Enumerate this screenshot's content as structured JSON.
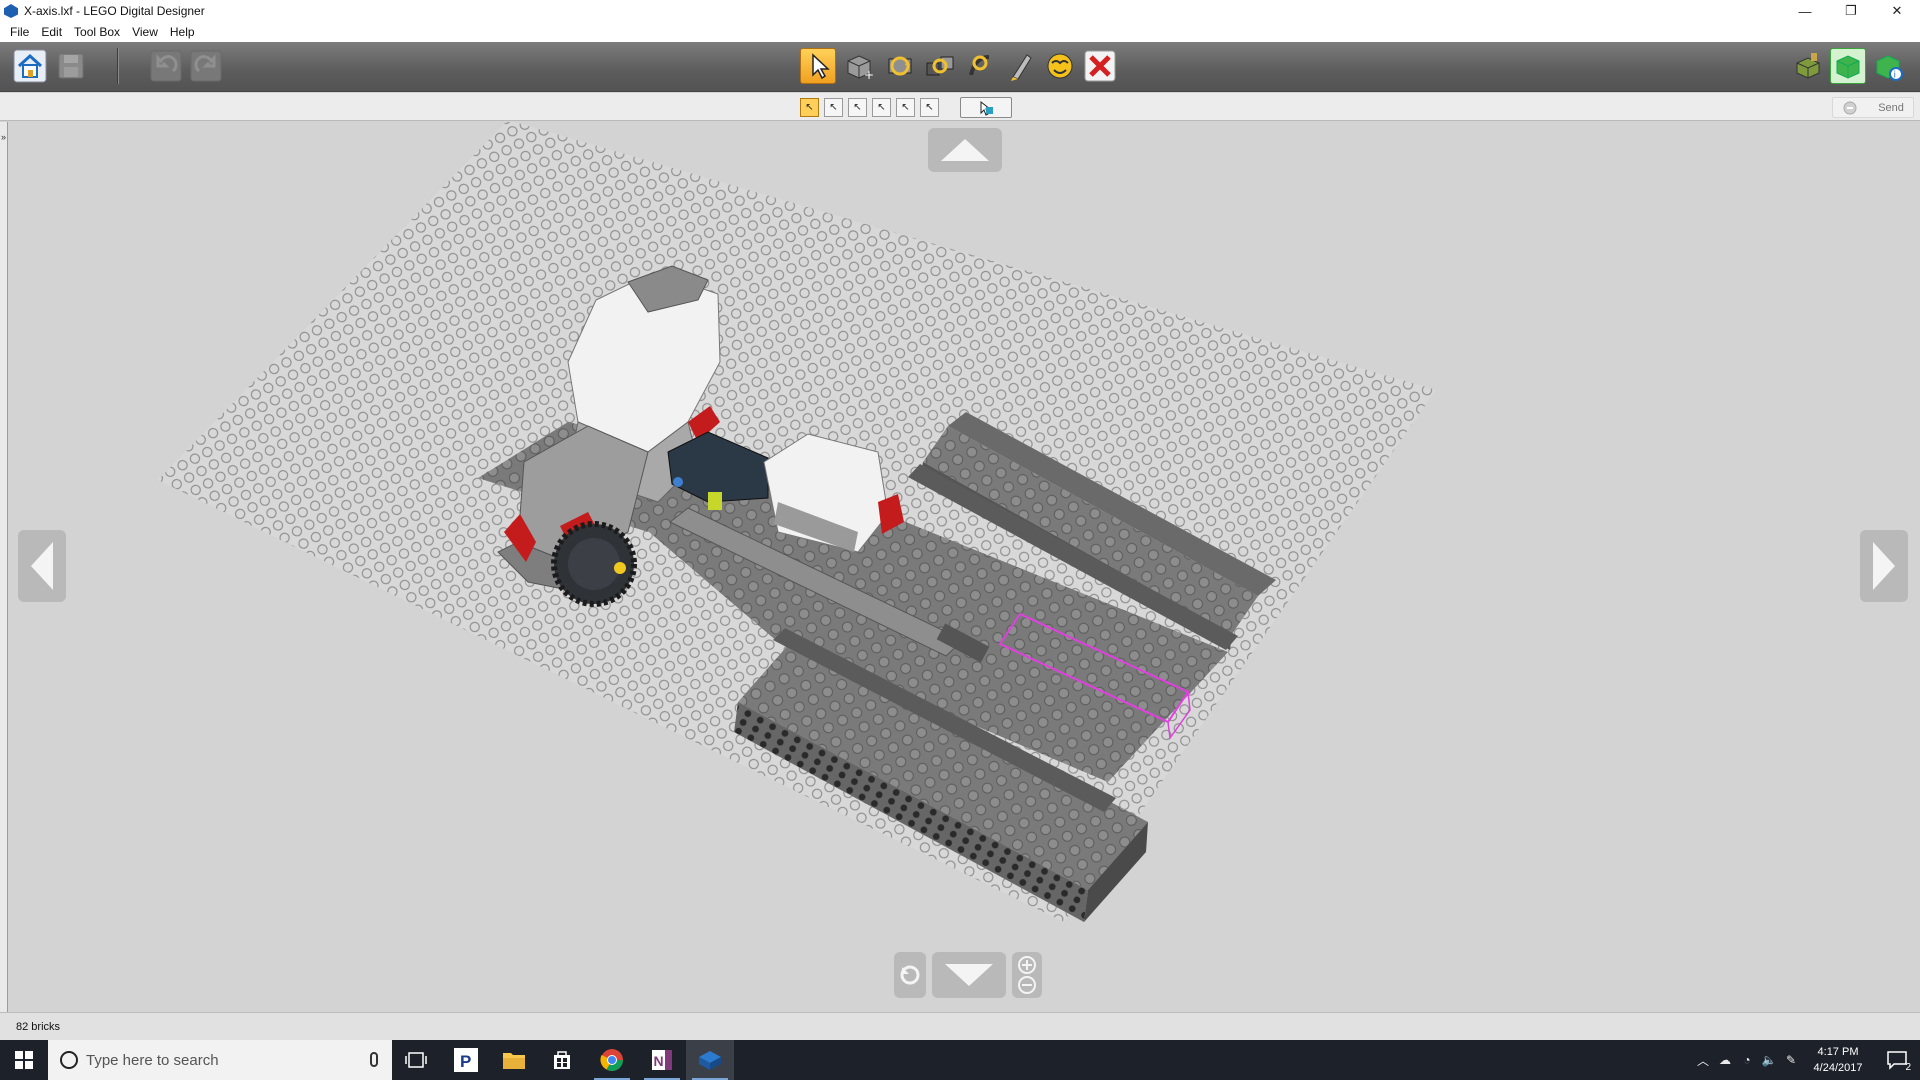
{
  "window": {
    "title": "X-axis.lxf - LEGO Digital Designer",
    "minimize_symbol": "—",
    "restore_symbol": "❐",
    "close_symbol": "✕"
  },
  "menu": [
    "File",
    "Edit",
    "Tool Box",
    "View",
    "Help"
  ],
  "toolbar": {
    "left_buttons": [
      "home-icon",
      "save-icon",
      "undo-icon",
      "redo-icon"
    ],
    "tool_buttons": [
      "select-tool-icon",
      "clone-tool-icon",
      "hinge-tool-icon",
      "hinge-align-tool-icon",
      "flex-tool-icon",
      "paint-tool-icon",
      "hide-tool-icon",
      "delete-tool-icon"
    ],
    "active_tool": "select-tool-icon",
    "mode_buttons": [
      "build-mode-icon",
      "view-mode-icon",
      "building-guide-icon"
    ]
  },
  "subtoolbar": {
    "select_modes": [
      "single-select-icon",
      "multi-select-icon",
      "connected-select-icon",
      "color-select-icon",
      "shape-select-icon",
      "invert-select-icon"
    ],
    "send_label": "Send"
  },
  "status": {
    "brick_count": "82 bricks"
  },
  "taskbar": {
    "search_placeholder": "Type here to search",
    "apps": [
      "task-view-icon",
      "pandora-icon",
      "file-explorer-icon",
      "store-icon",
      "chrome-icon",
      "onenote-icon",
      "lego-digital-designer-icon"
    ],
    "time": "4:17 PM",
    "date": "4/24/2017",
    "notification_count": "2"
  },
  "colors": {
    "accent_selected": "#ffc640",
    "selection_outline": "#e040e0",
    "baseplate": "#d6d6d6",
    "brick_dark_gray": "#6d6d6d",
    "taskbar": "#1d2129"
  }
}
